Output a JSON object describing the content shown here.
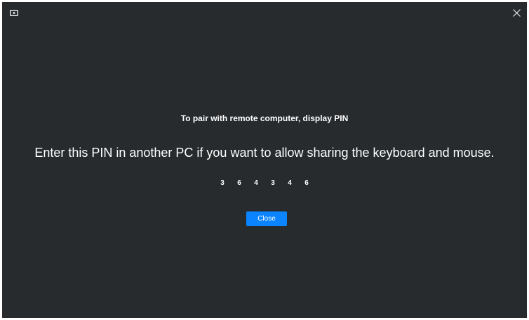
{
  "window": {
    "icon": "screen-icon",
    "close_icon": "close-icon"
  },
  "dialog": {
    "title": "To pair with remote computer, display PIN",
    "message": "Enter this PIN in another PC if you want to allow sharing the keyboard and mouse.",
    "pin_digits": [
      "3",
      "6",
      "4",
      "3",
      "4",
      "6"
    ],
    "close_label": "Close"
  },
  "colors": {
    "background": "#272b2e",
    "accent": "#0a84ff",
    "text": "#ffffff"
  }
}
